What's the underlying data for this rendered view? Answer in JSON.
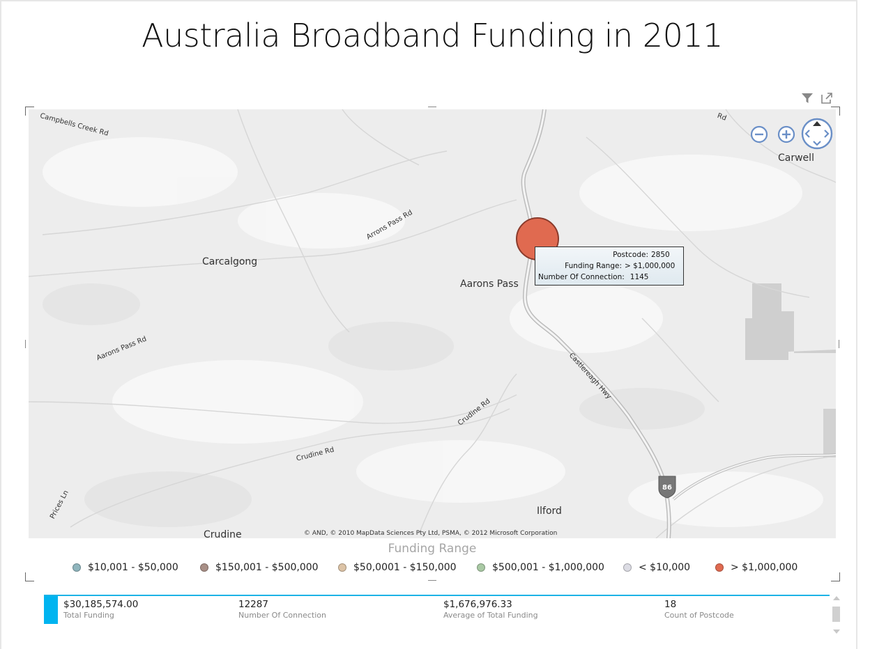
{
  "report": {
    "title": "Australia Broadband Funding in 2011"
  },
  "map": {
    "places": {
      "carcalgong": "Carcalgong",
      "aarons_pass": "Aarons Pass",
      "carwell": "Carwell",
      "ilford": "Ilford",
      "crudine": "Crudine"
    },
    "roads": {
      "campbells_creek": "Campbells Creek Rd",
      "arrons_pass": "Arrons Pass Rd",
      "aarons_pass_rd": "Aarons Pass Rd",
      "castlereagh": "Castlereagh Hwy",
      "crudine_rd_1": "Crudine Rd",
      "crudine_rd_2": "Crudine Rd",
      "prices_ln": "Prices Ln",
      "rd_top": "Rd",
      "hwy_shield": "86"
    },
    "copyright": "© AND, © 2010 MapData Sciences Pty Ltd, PSMA, © 2012 Microsoft Corporation",
    "bubble_color": "#e06a50",
    "tooltip": {
      "postcode_label": "Postcode:",
      "postcode_value": "2850",
      "range_label": "Funding Range:",
      "range_value": "> $1,000,000",
      "connection_label": "Number Of Connection:",
      "connection_value": "1145"
    }
  },
  "legend": {
    "title": "Funding Range",
    "items": [
      {
        "label": "$10,001 - $50,000",
        "color": "#8fb5bd"
      },
      {
        "label": "$150,001 - $500,000",
        "color": "#a88f86"
      },
      {
        "label": "$50,0001 - $150,000",
        "color": "#dcc3a6"
      },
      {
        "label": "$500,001 - $1,000,000",
        "color": "#a9c9a4"
      },
      {
        "label": "< $10,000",
        "color": "#dcdce4"
      },
      {
        "label": "> $1,000,000",
        "color": "#e06a50"
      }
    ]
  },
  "card": {
    "accent_color": "#00b4f0",
    "metrics": [
      {
        "value": "$30,185,574.00",
        "label": "Total Funding"
      },
      {
        "value": "12287",
        "label": "Number Of Connection"
      },
      {
        "value": "$1,676,976.33",
        "label": "Average of Total Funding"
      },
      {
        "value": "18",
        "label": "Count of Postcode"
      }
    ]
  }
}
